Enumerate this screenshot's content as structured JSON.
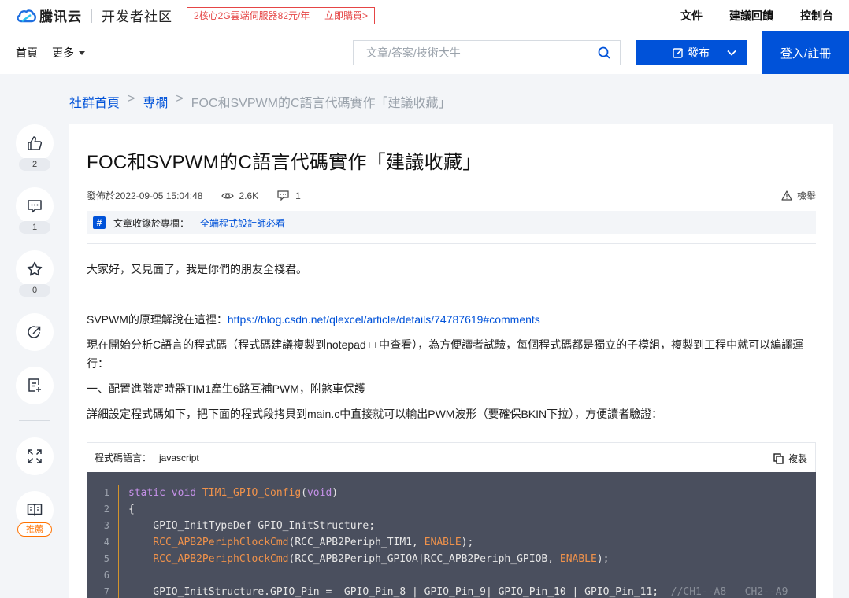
{
  "topbar": {
    "brand": "騰讯云",
    "sub_brand": "开发者社区",
    "promo": "2核心2G雲端伺服器82元/年 ｜ 立即購買>",
    "links": [
      "文件",
      "建議回饋",
      "控制台"
    ]
  },
  "navbar": {
    "home": "首頁",
    "more": "更多",
    "search_placeholder": "文章/答案/技術大牛",
    "publish": "發布",
    "login": "登入/註冊"
  },
  "breadcrumb": {
    "root": "社群首頁",
    "section": "專欄",
    "current": "FOC和SVPWM的C語言代碼實作「建議收藏」",
    "sep": ">"
  },
  "rail": {
    "like_count": "2",
    "comment_count": "1",
    "favorite_count": "0",
    "recommend_label": "推薦"
  },
  "article": {
    "title": "FOC和SVPWM的C語言代碼實作「建議收藏」",
    "published": "發佈於2022-09-05 15:04:48",
    "views": "2.6K",
    "comments": "1",
    "report": "檢舉",
    "column_label": "文章收錄於專欄：",
    "column_name": "全端程式設計師必看",
    "p1": "大家好，又見面了，我是你們的朋友全棧君。",
    "p2_prefix": "SVPWM的原理解說在這裡：",
    "p2_link": "https://blog.csdn.net/qlexcel/article/details/74787619#comments",
    "p3": "現在開始分析C語言的程式碼（程式碼建議複製到notepad++中查看），為方便讀者試驗，每個程式碼都是獨立的子模組，複製到工程中就可以編譯運行：",
    "p4": "一、配置進階定時器TIM1產生6路互補PWM，附煞車保護",
    "p5": "詳細設定程式碼如下，把下面的程式段拷貝到main.c中直接就可以輸出PWM波形（要確保BKIN下拉），方便讀者驗證："
  },
  "code": {
    "lang_label": "程式碼語言：",
    "lang": "javascript",
    "copy": "複製",
    "line_numbers": [
      "1",
      "2",
      "3",
      "4",
      "5",
      "6",
      "7"
    ],
    "lines": [
      {
        "segments": [
          {
            "t": "static void ",
            "c": "kw"
          },
          {
            "t": "TIM1_GPIO_Config",
            "c": "fn"
          },
          {
            "t": "(",
            "c": ""
          },
          {
            "t": "void",
            "c": "kw"
          },
          {
            "t": ")",
            "c": ""
          }
        ]
      },
      {
        "segments": [
          {
            "t": "{",
            "c": ""
          }
        ]
      },
      {
        "segments": [
          {
            "t": "    GPIO_InitTypeDef GPIO_InitStructure;",
            "c": ""
          }
        ]
      },
      {
        "segments": [
          {
            "t": "    ",
            "c": ""
          },
          {
            "t": "RCC_APB2PeriphClockCmd",
            "c": "fn"
          },
          {
            "t": "(RCC_APB2Periph_TIM1, ",
            "c": ""
          },
          {
            "t": "ENABLE",
            "c": "fn"
          },
          {
            "t": ");",
            "c": ""
          }
        ]
      },
      {
        "segments": [
          {
            "t": "    ",
            "c": ""
          },
          {
            "t": "RCC_APB2PeriphClockCmd",
            "c": "fn"
          },
          {
            "t": "(RCC_APB2Periph_GPIOA|RCC_APB2Periph_GPIOB, ",
            "c": ""
          },
          {
            "t": "ENABLE",
            "c": "fn"
          },
          {
            "t": ");",
            "c": ""
          }
        ]
      },
      {
        "segments": [
          {
            "t": "",
            "c": ""
          }
        ]
      },
      {
        "segments": [
          {
            "t": "    GPIO_InitStructure.GPIO_Pin =  GPIO_Pin_8 | GPIO_Pin_9| GPIO_Pin_10 | GPIO_Pin_11;  ",
            "c": ""
          },
          {
            "t": "//CH1--A8   CH2--A9",
            "c": "cm"
          }
        ]
      }
    ]
  },
  "colors": {
    "accent": "#0052d9",
    "promo_red": "#e54545",
    "recommend_orange": "#ff7200",
    "code_bg": "#4a4f5e"
  }
}
